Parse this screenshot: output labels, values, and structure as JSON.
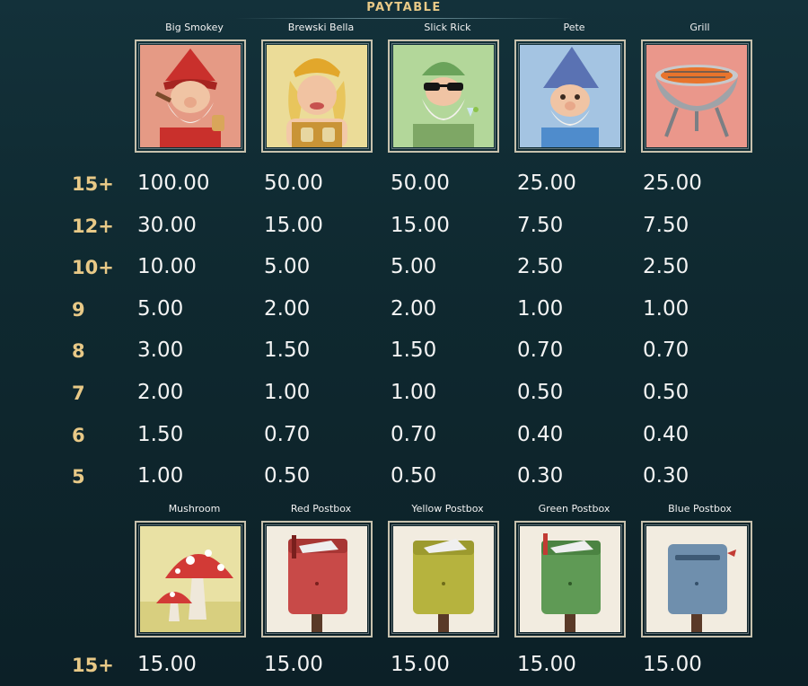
{
  "header": {
    "title": "PAYTABLE"
  },
  "top_section": {
    "symbols": [
      {
        "name": "Big Smokey",
        "icon": "big-smokey-gnome-icon",
        "bg": "#e9a08b"
      },
      {
        "name": "Brewski Bella",
        "icon": "brewski-bella-gnome-icon",
        "bg": "#efe3a3"
      },
      {
        "name": "Slick Rick",
        "icon": "slick-rick-gnome-icon",
        "bg": "#b6d99f"
      },
      {
        "name": "Pete",
        "icon": "pete-gnome-icon",
        "bg": "#a8c7e3"
      },
      {
        "name": "Grill",
        "icon": "grill-icon",
        "bg": "#ec9a8e"
      }
    ],
    "rows": [
      {
        "count": "15+",
        "values": [
          "100.00",
          "50.00",
          "50.00",
          "25.00",
          "25.00"
        ]
      },
      {
        "count": "12+",
        "values": [
          "30.00",
          "15.00",
          "15.00",
          "7.50",
          "7.50"
        ]
      },
      {
        "count": "10+",
        "values": [
          "10.00",
          "5.00",
          "5.00",
          "2.50",
          "2.50"
        ]
      },
      {
        "count": "9",
        "values": [
          "5.00",
          "2.00",
          "2.00",
          "1.00",
          "1.00"
        ]
      },
      {
        "count": "8",
        "values": [
          "3.00",
          "1.50",
          "1.50",
          "0.70",
          "0.70"
        ]
      },
      {
        "count": "7",
        "values": [
          "2.00",
          "1.00",
          "1.00",
          "0.50",
          "0.50"
        ]
      },
      {
        "count": "6",
        "values": [
          "1.50",
          "0.70",
          "0.70",
          "0.40",
          "0.40"
        ]
      },
      {
        "count": "5",
        "values": [
          "1.00",
          "0.50",
          "0.50",
          "0.30",
          "0.30"
        ]
      }
    ]
  },
  "bottom_section": {
    "symbols": [
      {
        "name": "Mushroom",
        "icon": "mushroom-icon",
        "bg": "#eae3a8"
      },
      {
        "name": "Red Postbox",
        "icon": "red-postbox-icon",
        "bg": "#f2ece0"
      },
      {
        "name": "Yellow Postbox",
        "icon": "yellow-postbox-icon",
        "bg": "#f2ece0"
      },
      {
        "name": "Green Postbox",
        "icon": "green-postbox-icon",
        "bg": "#f2ece0"
      },
      {
        "name": "Blue Postbox",
        "icon": "blue-postbox-icon",
        "bg": "#f2ece0"
      }
    ],
    "rows": [
      {
        "count": "15+",
        "values": [
          "15.00",
          "15.00",
          "15.00",
          "15.00",
          "15.00"
        ]
      }
    ]
  },
  "colors": {
    "accent": "#e8c987",
    "background": "#0f2930",
    "text": "#f4f4f4"
  }
}
